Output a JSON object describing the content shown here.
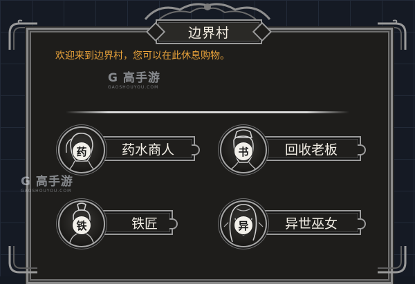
{
  "dialog": {
    "title": "边界村",
    "welcome": "欢迎来到边界村，您可以在此休息购物。"
  },
  "npcs": [
    {
      "name": "药水商人",
      "seal": "药",
      "icon": "potion-merchant-portrait"
    },
    {
      "name": "回收老板",
      "seal": "书",
      "icon": "recycle-boss-portrait"
    },
    {
      "name": "铁匠",
      "seal": "铁",
      "icon": "blacksmith-portrait"
    },
    {
      "name": "异世巫女",
      "seal": "异",
      "icon": "shrine-maiden-portrait"
    }
  ],
  "watermarks": [
    {
      "brand": "G 高手游",
      "site": "GAOSHOUYOU.COM"
    },
    {
      "brand": "G 高手游",
      "site": "GAOSHOUYOU.COM"
    }
  ],
  "colors": {
    "welcome_text": "#e8a23a",
    "panel_bg": "#1e1d1b",
    "frame": "#8b8b8b",
    "background": "#151a24"
  }
}
